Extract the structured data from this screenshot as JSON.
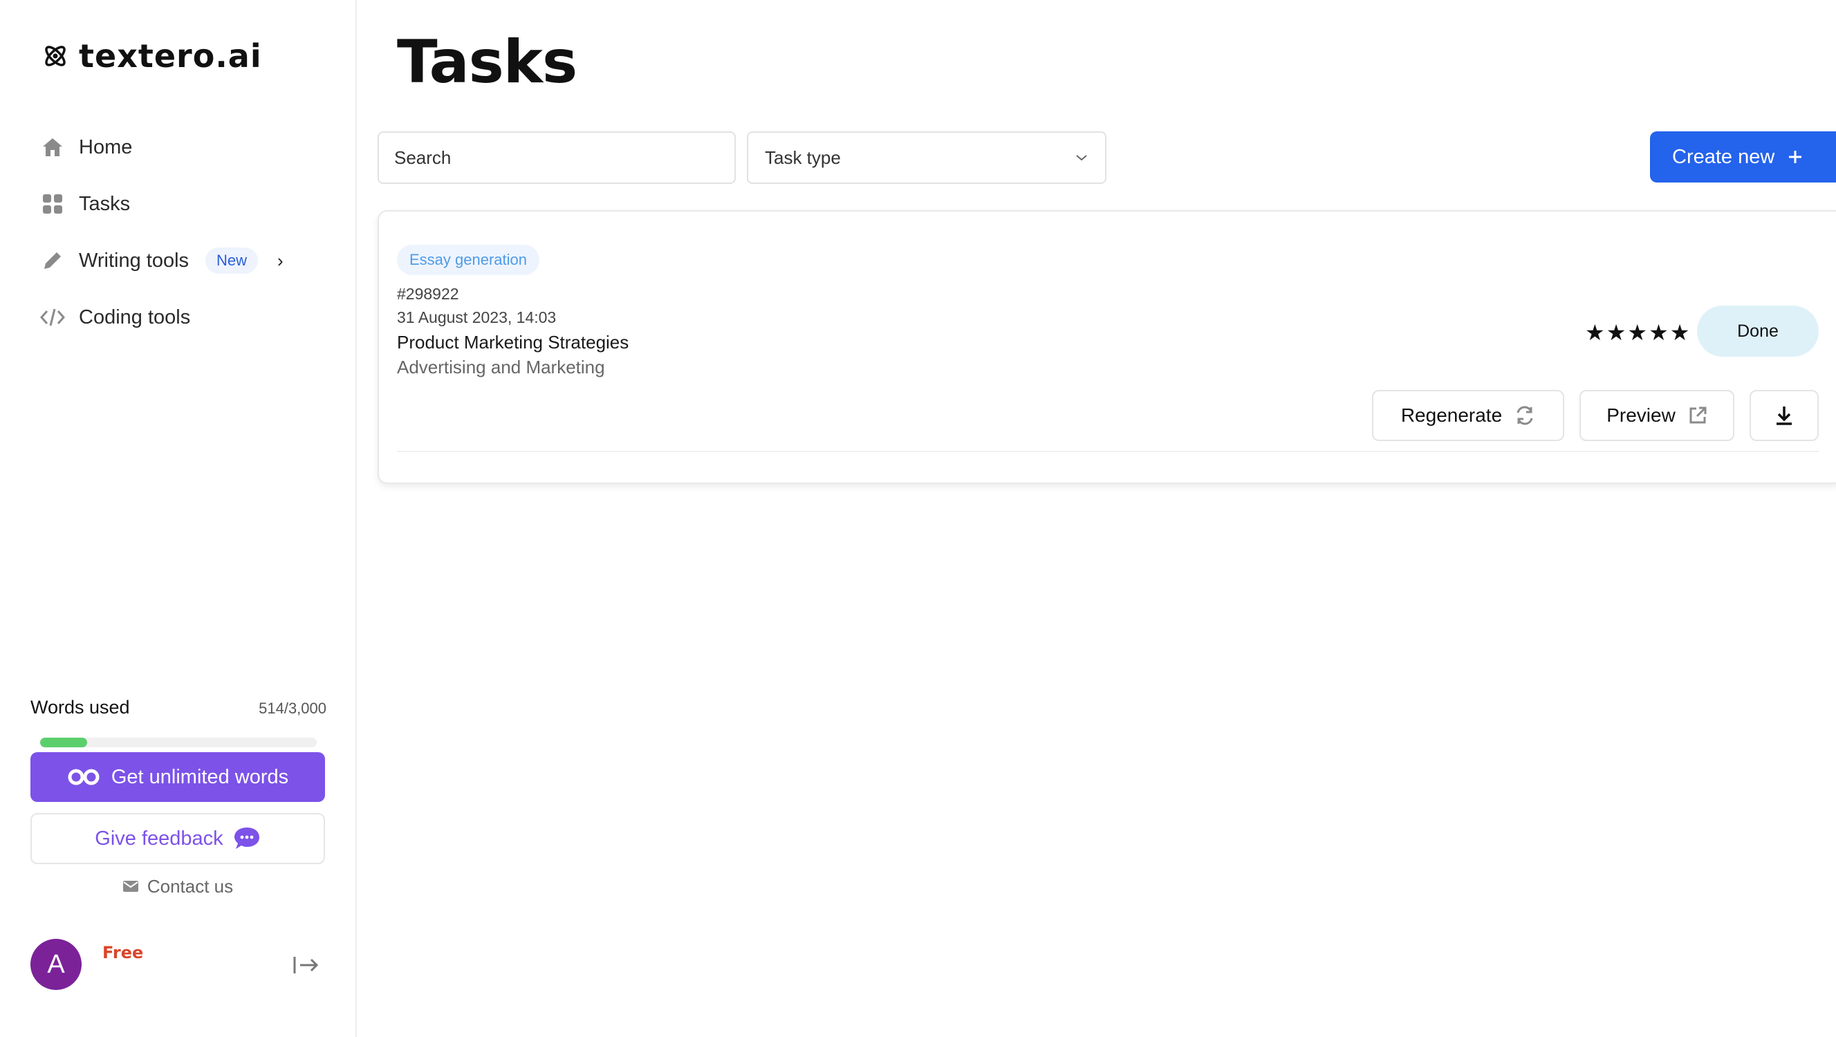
{
  "app": {
    "logo_text": "textero.ai",
    "logo_icon": "atom-icon"
  },
  "sidebar": {
    "items": [
      {
        "label": "Home",
        "icon": "home-icon"
      },
      {
        "label": "Tasks",
        "icon": "grid-icon"
      },
      {
        "label": "Writing tools",
        "icon": "pencil-icon",
        "badge": "New"
      },
      {
        "label": "Coding tools",
        "icon": "code-icon"
      }
    ],
    "words": {
      "label": "Words used",
      "count": "514/3,000",
      "progress": 0.17
    },
    "unlimited_label": "Get unlimited words",
    "feedback_label": "Give feedback",
    "contact_label": "Contact us",
    "user": {
      "initial": "A",
      "plan": "Free"
    }
  },
  "main": {
    "title": "Tasks",
    "search_placeholder": "Search",
    "task_type_label": "Task type",
    "create_label": "Create new",
    "tasks": [
      {
        "tag": "Essay generation",
        "id": "#298922",
        "date": "31 August 2023, 14:03",
        "title": "Product Marketing Strategies",
        "subtitle": "Advertising and Marketing",
        "rating": 5,
        "stars": "★★★★★",
        "status": "Done",
        "regenerate_label": "Regenerate",
        "preview_label": "Preview"
      }
    ]
  },
  "colors": {
    "primary_blue": "#2463eb",
    "purple": "#7c52e8",
    "progress_green": "#5ccf6d",
    "plan_orange": "#d9462a",
    "avatar_purple": "#7b2299",
    "status_bg": "#dff1f8"
  }
}
